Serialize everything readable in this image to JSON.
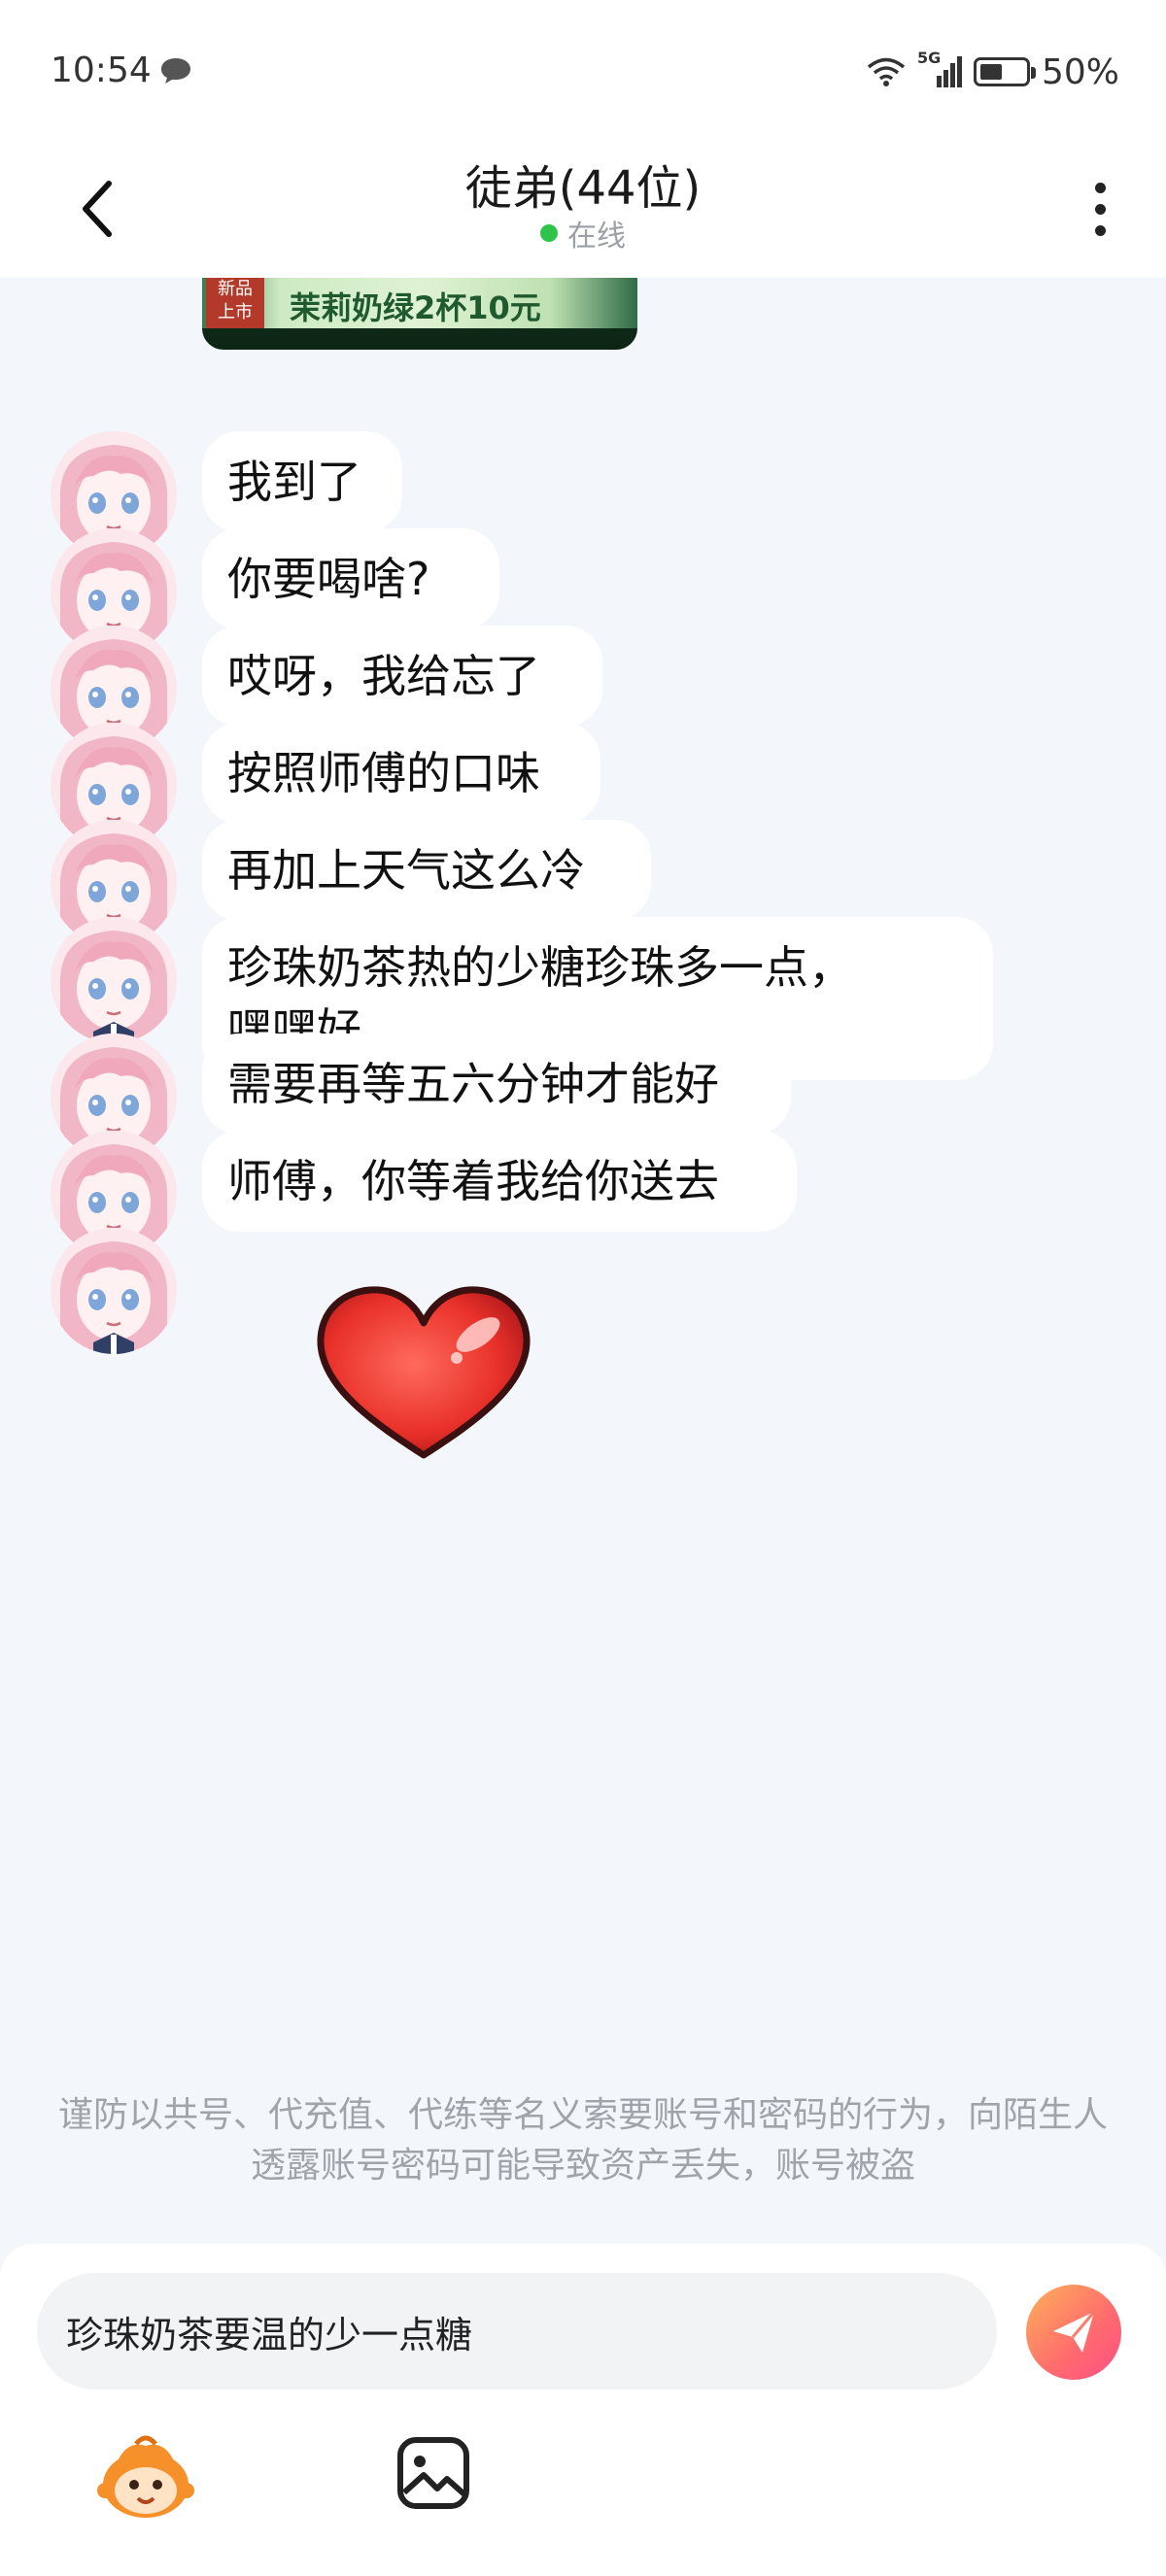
{
  "status_bar": {
    "time": "10:54",
    "network": "5G",
    "battery": "50%",
    "battery_level": 0.5,
    "icons": [
      "chat-bubble-icon",
      "wifi-icon",
      "signal-icon",
      "battery-icon"
    ]
  },
  "header": {
    "title": "徒弟(44位)",
    "status": "在线",
    "status_color": "#2ec44a"
  },
  "chat": {
    "image_message": {
      "badge": "新品\n上市",
      "text": "茉莉奶绿2杯10元"
    },
    "messages": [
      {
        "text": "我到了"
      },
      {
        "text": "你要喝啥?"
      },
      {
        "text": "哎呀，我给忘了"
      },
      {
        "text": "按照师傅的口味"
      },
      {
        "text": "再加上天气这么冷"
      },
      {
        "text": "珍珠奶茶热的少糖珍珠多一点，\n嘿嘿好"
      },
      {
        "text": "需要再等五六分钟才能好"
      },
      {
        "text": "师傅，你等着我给你送去"
      }
    ],
    "sticker": "heart-sticker"
  },
  "notice": "谨防以共号、代充值、代练等名义索要账号和密码的行为，向陌生人透露账号密码可能导致资产丢失，账号被盗",
  "input": {
    "value": "珍珠奶茶要温的少一点糖"
  },
  "colors": {
    "background": "#f3f6fa",
    "bubble": "#ffffff",
    "send_gradient_start": "#ffb15a",
    "send_gradient_end": "#ff4f86"
  }
}
